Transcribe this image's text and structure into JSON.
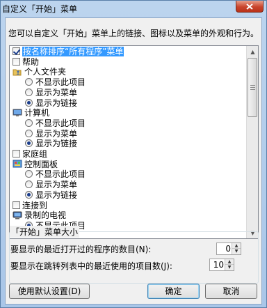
{
  "window": {
    "title": "自定义「开始」菜单"
  },
  "description": "您可以自定义「开始」菜单上的链接、图标以及菜单的外观和行为。",
  "list": {
    "items": [
      {
        "type": "checkbox",
        "label": "按名称排序“所有程序”菜单",
        "checked": true,
        "selected": true
      },
      {
        "type": "checkbox",
        "label": "帮助",
        "checked": false
      },
      {
        "type": "header",
        "icon": "folder-user-icon",
        "label": "个人文件夹"
      },
      {
        "type": "radio",
        "label": "不显示此项目",
        "checked": false
      },
      {
        "type": "radio",
        "label": "显示为菜单",
        "checked": false
      },
      {
        "type": "radio",
        "label": "显示为链接",
        "checked": true
      },
      {
        "type": "header",
        "icon": "computer-icon",
        "label": "计算机"
      },
      {
        "type": "radio",
        "label": "不显示此项目",
        "checked": false
      },
      {
        "type": "radio",
        "label": "显示为菜单",
        "checked": false
      },
      {
        "type": "radio",
        "label": "显示为链接",
        "checked": true
      },
      {
        "type": "checkbox",
        "label": "家庭组",
        "checked": false
      },
      {
        "type": "header",
        "icon": "control-panel-icon",
        "label": "控制面板"
      },
      {
        "type": "radio",
        "label": "不显示此项目",
        "checked": false
      },
      {
        "type": "radio",
        "label": "显示为菜单",
        "checked": false
      },
      {
        "type": "radio",
        "label": "显示为链接",
        "checked": true
      },
      {
        "type": "checkbox",
        "label": "连接到",
        "checked": false
      },
      {
        "type": "header",
        "icon": "tv-icon",
        "label": "录制的电视"
      },
      {
        "type": "radio",
        "label": "不显示此项目",
        "checked": true
      }
    ]
  },
  "size_group": {
    "title": "「开始」菜单大小",
    "recent_programs_label": "要显示的最近打开过的程序的数目(N):",
    "recent_programs_value": "0",
    "jump_list_label": "要显示在跳转列表中的最近使用的项目数(J):",
    "jump_list_value": "10"
  },
  "buttons": {
    "defaults": "使用默认设置(D)",
    "ok": "确定",
    "cancel": "取消"
  },
  "icons": {
    "close": "close-icon",
    "scroll_up": "scroll-up-icon",
    "scroll_down": "scroll-down-icon"
  },
  "colors": {
    "selection": "#3399ff",
    "close_button": "#c9452d",
    "title_bar": "#bcd4ee"
  }
}
